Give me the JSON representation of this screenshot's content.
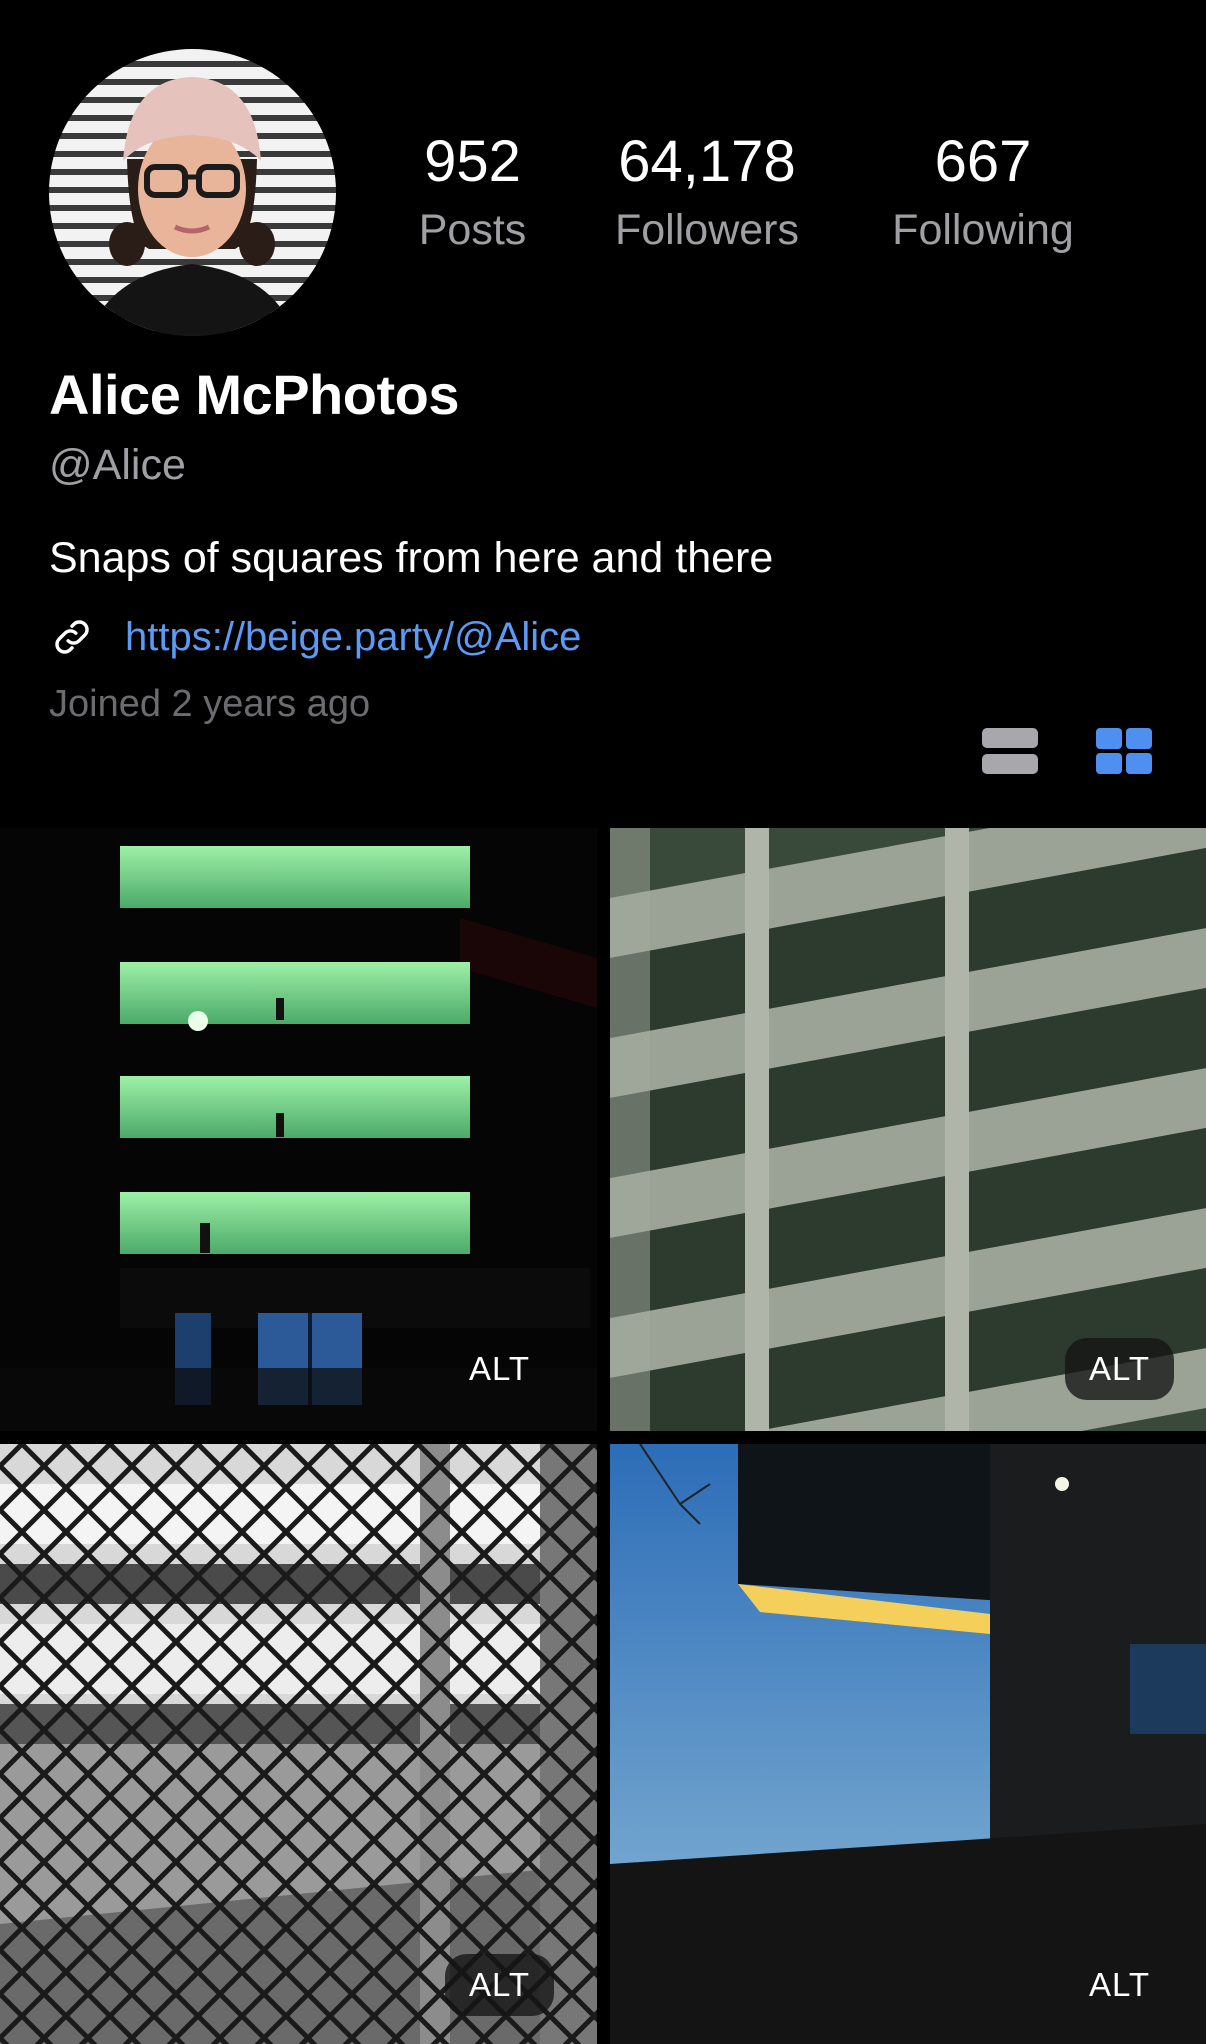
{
  "profile": {
    "display_name": "Alice McPhotos",
    "handle": "@Alice",
    "bio": "Snaps of squares from here and there",
    "link": "https://beige.party/@Alice",
    "joined": "Joined 2 years ago"
  },
  "stats": {
    "posts": {
      "value": "952",
      "label": "Posts"
    },
    "followers": {
      "value": "64,178",
      "label": "Followers"
    },
    "following": {
      "value": "667",
      "label": "Following"
    }
  },
  "view_toggle": {
    "list_icon": "list-view-icon",
    "grid_icon": "grid-view-icon",
    "active": "grid",
    "active_color": "#4f8ff0",
    "inactive_color": "#a8a8ac"
  },
  "grid": {
    "tiles": [
      {
        "subject": "green-lit-parking-garage-night",
        "alt": "ALT"
      },
      {
        "subject": "concrete-parking-structure",
        "alt": "ALT"
      },
      {
        "subject": "chain-link-fence-garage",
        "alt": "ALT"
      },
      {
        "subject": "building-overhang-blue-sky",
        "alt": "ALT"
      }
    ]
  },
  "colors": {
    "background": "#000000",
    "text_primary": "#ffffff",
    "text_secondary": "#a0a0a4",
    "link": "#5c9bf5"
  }
}
